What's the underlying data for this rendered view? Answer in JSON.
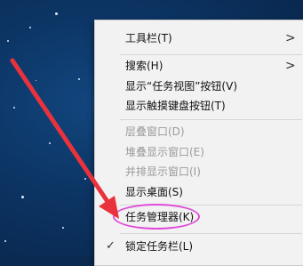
{
  "context_menu": {
    "items": [
      {
        "label": "工具栏(T)",
        "submenu": true
      },
      {
        "label": "搜索(H)",
        "submenu": true
      },
      {
        "label": "显示“任务视图”按钮(V)"
      },
      {
        "label": "显示触摸键盘按钮(T)"
      },
      {
        "label": "层叠窗口(D)",
        "disabled": true
      },
      {
        "label": "堆叠显示窗口(E)",
        "disabled": true
      },
      {
        "label": "并排显示窗口(I)",
        "disabled": true
      },
      {
        "label": "显示桌面(S)"
      },
      {
        "label": "任务管理器(K)",
        "highlighted": true
      },
      {
        "label": "锁定任务栏(L)",
        "checked": true
      }
    ],
    "submenu_glyph": ">",
    "check_glyph": "✓"
  },
  "annotation": {
    "arrow_color": "#e8323c",
    "highlight_color": "#e04bd9"
  }
}
